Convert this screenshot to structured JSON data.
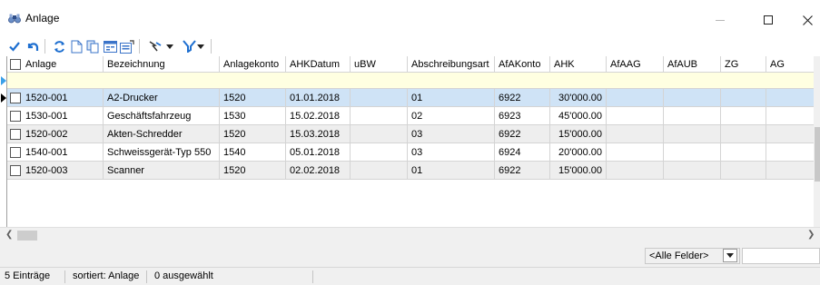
{
  "window": {
    "title": "Anlage",
    "icon": "binoculars-icon"
  },
  "toolbar": {
    "icons": [
      "check-icon",
      "undo-icon",
      "refresh-icon",
      "new-document-icon",
      "copy-icon",
      "form-view-icon",
      "properties-icon",
      "pointer-tool-icon",
      "filter-icon"
    ]
  },
  "grid": {
    "columns": [
      "Anlage",
      "Bezeichnung",
      "Anlagekonto",
      "AHKDatum",
      "uBW",
      "Abschreibungsart",
      "AfAKonto",
      "AHK",
      "AfAAG",
      "AfAUB",
      "ZG",
      "AG"
    ],
    "rows": [
      {
        "anlage": "1520-001",
        "bezeichnung": "A2-Drucker",
        "anlagekonto": "1520",
        "ahkdatum": "01.01.2018",
        "ubw": "",
        "abschreibungsart": "01",
        "afakonto": "6922",
        "ahk": "30'000.00"
      },
      {
        "anlage": "1530-001",
        "bezeichnung": "Geschäftsfahrzeug",
        "anlagekonto": "1530",
        "ahkdatum": "15.02.2018",
        "ubw": "",
        "abschreibungsart": "02",
        "afakonto": "6923",
        "ahk": "45'000.00"
      },
      {
        "anlage": "1520-002",
        "bezeichnung": "Akten-Schredder",
        "anlagekonto": "1520",
        "ahkdatum": "15.03.2018",
        "ubw": "",
        "abschreibungsart": "03",
        "afakonto": "6922",
        "ahk": "15'000.00"
      },
      {
        "anlage": "1540-001",
        "bezeichnung": "Schweissgerät-Typ 550",
        "anlagekonto": "1540",
        "ahkdatum": "05.01.2018",
        "ubw": "",
        "abschreibungsart": "03",
        "afakonto": "6924",
        "ahk": "20'000.00"
      },
      {
        "anlage": "1520-003",
        "bezeichnung": "Scanner",
        "anlagekonto": "1520",
        "ahkdatum": "02.02.2018",
        "ubw": "",
        "abschreibungsart": "01",
        "afakonto": "6922",
        "ahk": "15'000.00"
      }
    ]
  },
  "fieldfilter": {
    "selected": "<Alle Felder>"
  },
  "status": {
    "count": "5 Einträge",
    "sorted": "sortiert: Anlage",
    "selected": "0 ausgewählt"
  },
  "colors": {
    "selected_row": "#cfe3f6",
    "alt_row": "#eeeeee",
    "filter_row": "#ffffe1",
    "toolbar_blue": "#1e6fd0"
  }
}
